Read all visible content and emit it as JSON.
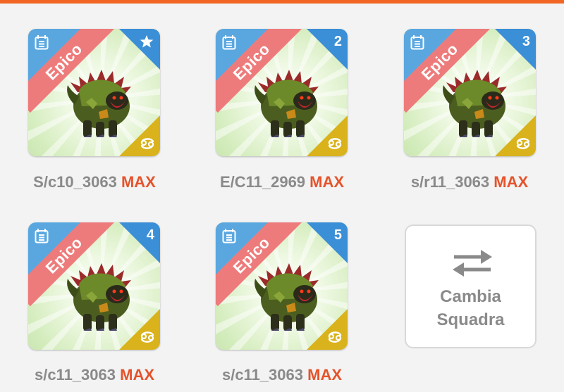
{
  "team": [
    {
      "rarity": "Epico",
      "slot_badge": "",
      "slot_icon": "star-icon",
      "name": "S/c10_3063",
      "level_tag": "MAX"
    },
    {
      "rarity": "Epico",
      "slot_badge": "2",
      "slot_icon": "",
      "name": "E/C11_2969",
      "level_tag": "MAX"
    },
    {
      "rarity": "Epico",
      "slot_badge": "3",
      "slot_icon": "",
      "name": "s/r11_3063",
      "level_tag": "MAX"
    },
    {
      "rarity": "Epico",
      "slot_badge": "4",
      "slot_icon": "",
      "name": "s/c11_3063",
      "level_tag": "MAX"
    },
    {
      "rarity": "Epico",
      "slot_badge": "5",
      "slot_icon": "",
      "name": "s/c11_3063",
      "level_tag": "MAX"
    }
  ],
  "swap_team": {
    "line1": "Cambia",
    "line2": "Squadra",
    "icon": "swap-arrows-icon"
  },
  "colors": {
    "accent": "#f26522",
    "max": "#e5532b",
    "rarity_ribbon": "#ee7b7b",
    "badge_blue": "#3b8fd6",
    "zodiac_gold": "#d9b21c"
  }
}
